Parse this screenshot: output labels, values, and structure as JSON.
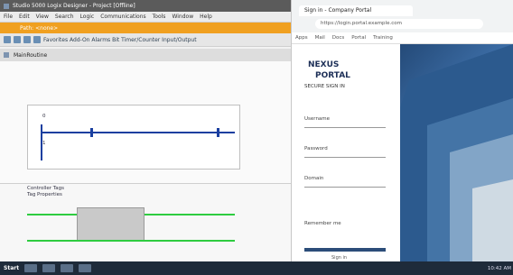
{
  "left_window": {
    "title": "Studio 5000 Logix Designer - Project [Offline]",
    "menu": [
      "File",
      "Edit",
      "View",
      "Search",
      "Logic",
      "Communications",
      "Tools",
      "Window",
      "Help"
    ],
    "banner": "Path: <none>",
    "toolbar_label": "Favorites  Add-On  Alarms  Bit  Timer/Counter  Input/Output",
    "ladder_tab": "MainRoutine",
    "rung_label_1": "0",
    "rung_label_2": "1",
    "rung_label_lower": "Controller Tags",
    "lower_label": "Tag Properties"
  },
  "right_window": {
    "tab_title": "Sign in - Company Portal",
    "url": "https://login.portal.example.com",
    "bookmarks": [
      "Apps",
      "Mail",
      "Docs",
      "Portal",
      "Training"
    ],
    "login": {
      "brand_line1": "NEXUS",
      "brand_line2": "PORTAL",
      "brand_line3": "SECURE SIGN IN",
      "field_user": "Username",
      "field_pass": "Password",
      "field_domain": "Domain",
      "remember": "Remember me",
      "sign_in": "Sign in"
    }
  },
  "taskbar": {
    "start": "Start",
    "clock": "10:42 AM"
  },
  "colors": {
    "orange": "#f0a020",
    "rail_blue": "#1a3fa0",
    "green": "#2ecc40"
  }
}
